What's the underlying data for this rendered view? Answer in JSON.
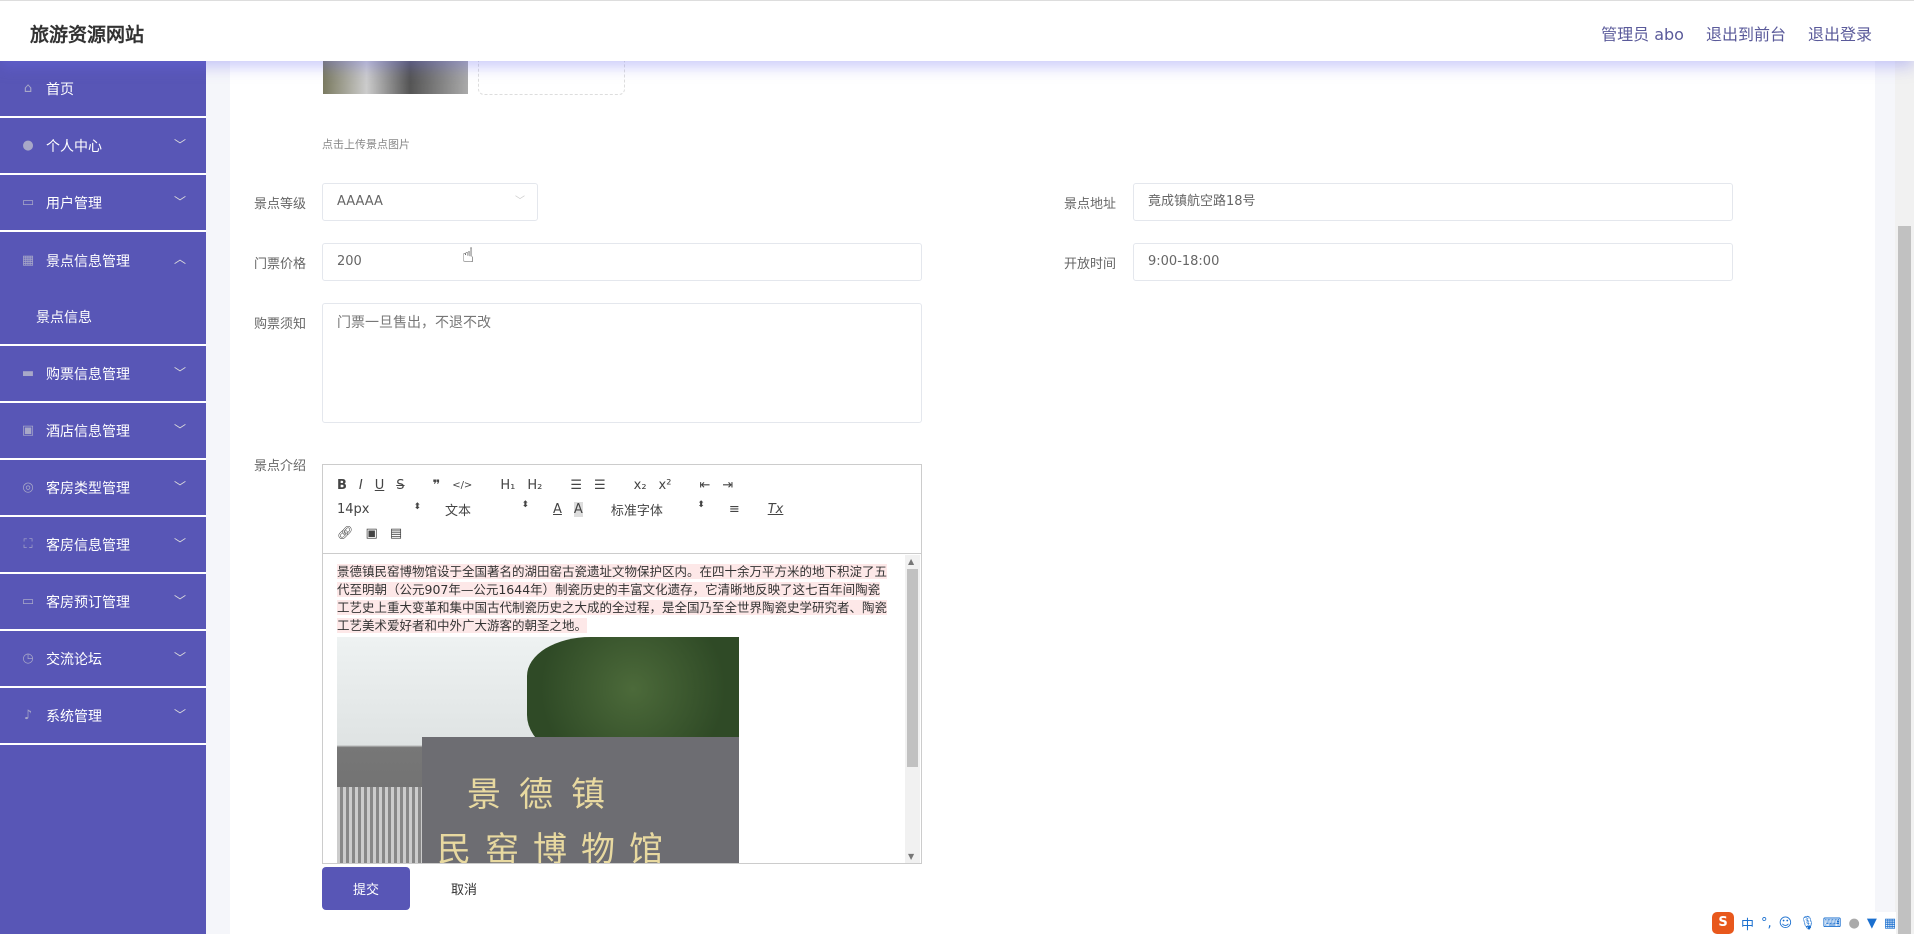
{
  "header": {
    "title": "旅游资源网站",
    "user": "管理员 abo",
    "to_front": "退出到前台",
    "logout": "退出登录"
  },
  "sidebar": {
    "items": [
      {
        "label": "首页",
        "icon": "home-icon",
        "glyph": "⌂"
      },
      {
        "label": "个人中心",
        "icon": "user-icon",
        "glyph": "●"
      },
      {
        "label": "用户管理",
        "icon": "chat-icon",
        "glyph": "▭"
      },
      {
        "label": "景点信息管理",
        "icon": "grid-icon",
        "glyph": "▦"
      },
      {
        "label": "购票信息管理",
        "icon": "message-icon",
        "glyph": "▬"
      },
      {
        "label": "酒店信息管理",
        "icon": "clipboard-icon",
        "glyph": "▣"
      },
      {
        "label": "客房类型管理",
        "icon": "lifebuoy-icon",
        "glyph": "◎"
      },
      {
        "label": "客房信息管理",
        "icon": "fullscreen-icon",
        "glyph": "⛶"
      },
      {
        "label": "客房预订管理",
        "icon": "postcard-icon",
        "glyph": "▭"
      },
      {
        "label": "交流论坛",
        "icon": "compass-icon",
        "glyph": "◷"
      },
      {
        "label": "系统管理",
        "icon": "microphone-icon",
        "glyph": "♪"
      }
    ],
    "sub_item": "景点信息"
  },
  "form": {
    "upload_tip": "点击上传景点图片",
    "level_label": "景点等级",
    "level_value": "AAAAA",
    "address_label": "景点地址",
    "address_value": "竟成镇航空路18号",
    "price_label": "门票价格",
    "price_value": "200",
    "hours_label": "开放时间",
    "hours_value": "9:00-18:00",
    "notice_label": "购票须知",
    "notice_value": "门票一旦售出，不退不改",
    "intro_label": "景点介绍",
    "intro_text": " 景德镇民窑博物馆设于全国著名的湖田窑古瓷遗址文物保护区内。在四十余万平方米的地下积淀了五代至明朝（公元907年—公元1644年）制瓷历史的丰富文化遗存，它清晰地反映了这七百年间陶瓷工艺史上重大变革和集中国古代制瓷历史之大成的全过程，是全国乃至全世界陶瓷史学研究者、陶瓷工艺美术爱好者和中外广大游客的朝圣之地。",
    "sign_line1": "景德镇",
    "sign_line2": "民窑博物馆",
    "submit": "提交",
    "cancel": "取消"
  },
  "editor": {
    "font_size": "14px",
    "heading": "文本",
    "font_family": "标准字体"
  },
  "ime": {
    "lang": "中",
    "punct": "°,"
  }
}
